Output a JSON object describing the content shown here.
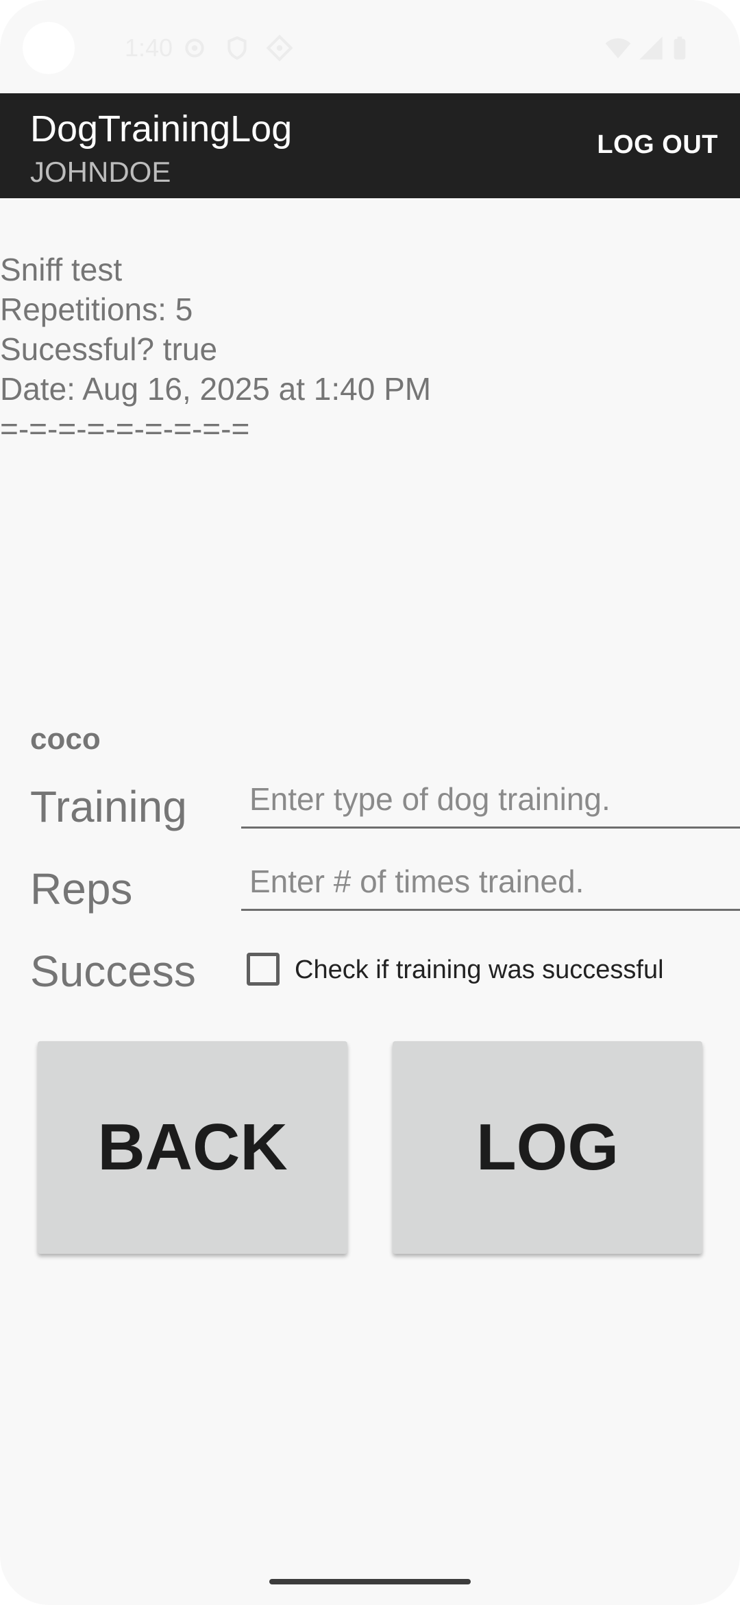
{
  "status_bar": {
    "time": "1:40",
    "icons": [
      "settings-icon",
      "shield-icon",
      "location-icon",
      "wifi-icon",
      "signal-icon",
      "battery-icon"
    ]
  },
  "app_bar": {
    "title": "DogTrainingLog",
    "subtitle": "JOHNDOE",
    "logout_label": "LOG OUT"
  },
  "log_entries": [
    {
      "training": "Sniff test",
      "reps": "Repetitions: 5",
      "success": "Sucessful? true",
      "date": "Date: Aug 16, 2025 at 1:40 PM",
      "separator": "=-=-=-=-=-=-=-=-="
    }
  ],
  "form": {
    "dog_name": "coco",
    "training_label": "Training",
    "training_placeholder": "Enter type of dog training.",
    "training_value": "",
    "reps_label": "Reps",
    "reps_placeholder": "Enter # of times trained.",
    "reps_value": "",
    "success_label": "Success",
    "success_checkbox_label": "Check if training was successful",
    "success_checked": false
  },
  "buttons": {
    "back_label": "BACK",
    "log_label": "LOG"
  },
  "colors": {
    "app_bar": "#212121",
    "background": "#f8f8f8",
    "button_bg": "#d6d7d7",
    "secondary_text": "#757575"
  }
}
